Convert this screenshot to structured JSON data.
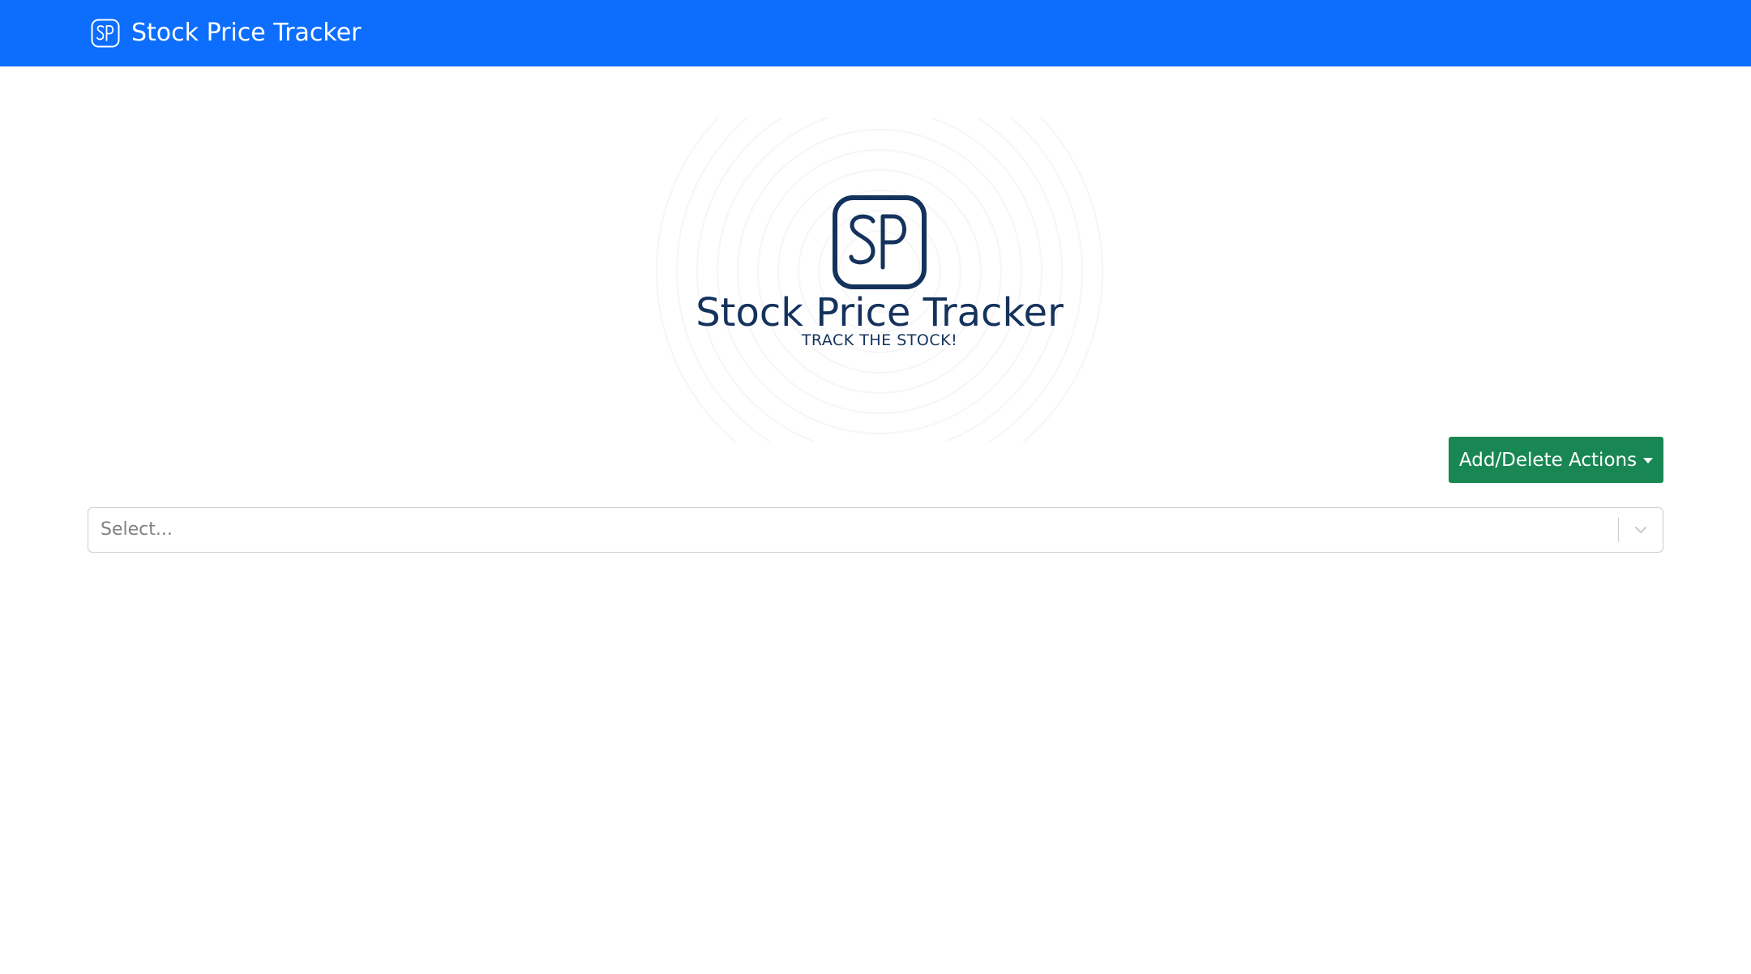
{
  "navbar": {
    "brand_logo_text": "SP",
    "brand_title": "Stock Price Tracker",
    "background_color": "#0d6efd"
  },
  "hero": {
    "logo_text": "SP",
    "title": "Stock Price Tracker",
    "tagline": "TRACK THE STOCK!",
    "text_color": "#14325c"
  },
  "actions": {
    "dropdown_label": "Add/Delete Actions",
    "button_color": "#198754"
  },
  "stock_select": {
    "placeholder": "Select...",
    "indicator_icon": "chevron-down-icon"
  }
}
